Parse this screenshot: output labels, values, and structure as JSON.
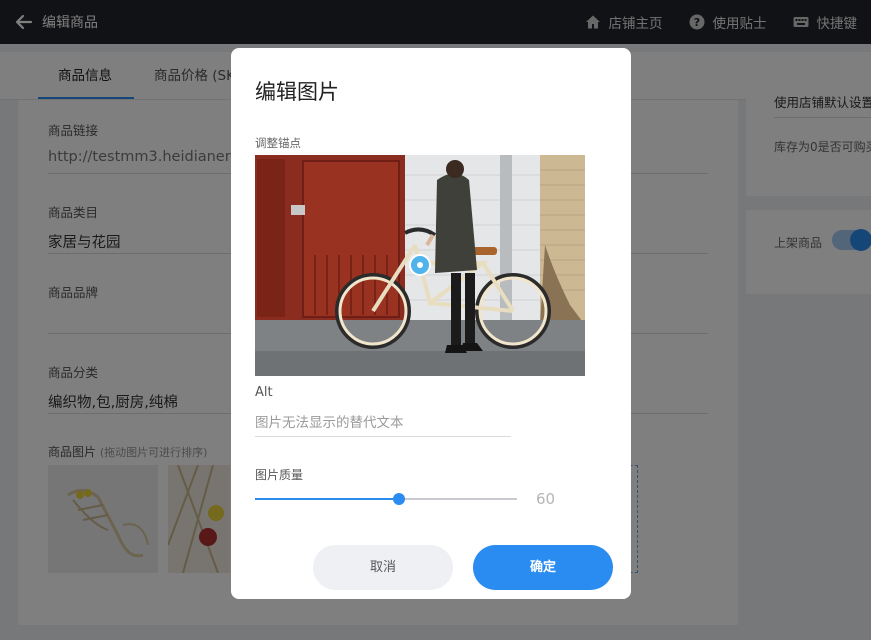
{
  "topbar": {
    "back_title": "编辑商品",
    "links": [
      {
        "label": "店铺主页",
        "icon": "home-icon"
      },
      {
        "label": "使用贴士",
        "icon": "help-icon"
      },
      {
        "label": "快捷键",
        "icon": "keyboard-icon"
      }
    ]
  },
  "tabs": [
    "商品信息",
    "商品价格 (SK"
  ],
  "form": {
    "link": {
      "label": "商品链接",
      "value": "http://testmm3.heidianer."
    },
    "category": {
      "label": "商品类目",
      "value": "家居与花园"
    },
    "brand": {
      "label": "商品品牌",
      "value": ""
    },
    "classification": {
      "label": "商品分类",
      "value": "编织物,包,厨房,纯棉"
    },
    "images": {
      "label": "商品图片",
      "hint": "(拖动图片可进行排序)"
    }
  },
  "right_panel": {
    "select_value": "使用店铺默认设置",
    "stock_text": "库存为0是否可购买",
    "listing_label": "上架商品",
    "listing_on": true
  },
  "modal": {
    "title": "编辑图片",
    "anchor_label": "调整锚点",
    "alt_label": "Alt",
    "alt_placeholder": "图片无法显示的替代文本",
    "alt_value": "",
    "quality_label": "图片质量",
    "quality_value": 60,
    "quality_display": "60",
    "cancel_label": "取消",
    "confirm_label": "确定"
  },
  "colors": {
    "accent": "#2a8cf0",
    "topbar": "#22252b"
  }
}
